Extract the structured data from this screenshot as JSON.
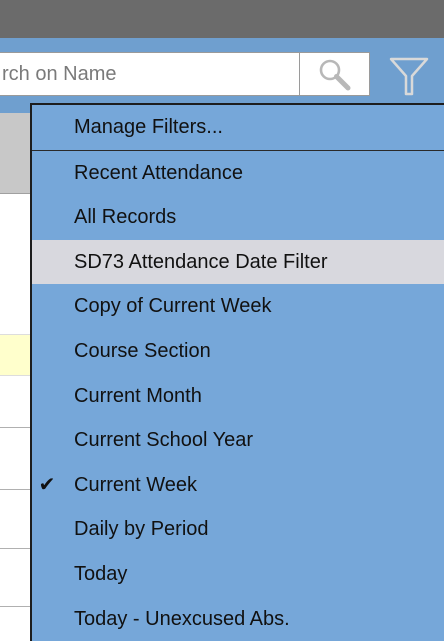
{
  "search": {
    "placeholder": "rch on Name"
  },
  "toolbar": {
    "search_icon": "magnifier-icon",
    "filter_icon": "funnel-icon"
  },
  "filter_menu": {
    "items": [
      {
        "label": "Manage Filters..."
      },
      {
        "label": "Recent Attendance"
      },
      {
        "label": "All Records"
      },
      {
        "label": "SD73 Attendance Date Filter"
      },
      {
        "label": "Copy of Current Week"
      },
      {
        "label": "Course Section"
      },
      {
        "label": "Current Month"
      },
      {
        "label": "Current School Year"
      },
      {
        "label": "Current Week",
        "checked": true
      },
      {
        "label": "Daily by Period"
      },
      {
        "label": "Today"
      },
      {
        "label": "Today - Unexcused Abs."
      }
    ],
    "highlighted_item": "SD73 Attendance Date Filter",
    "check_glyph": "✔"
  },
  "colors": {
    "header": "#6b6b6b",
    "toolbar": "#6f9fcf",
    "menu_background": "#76a7d9",
    "menu_highlight": "#d8d8de"
  }
}
